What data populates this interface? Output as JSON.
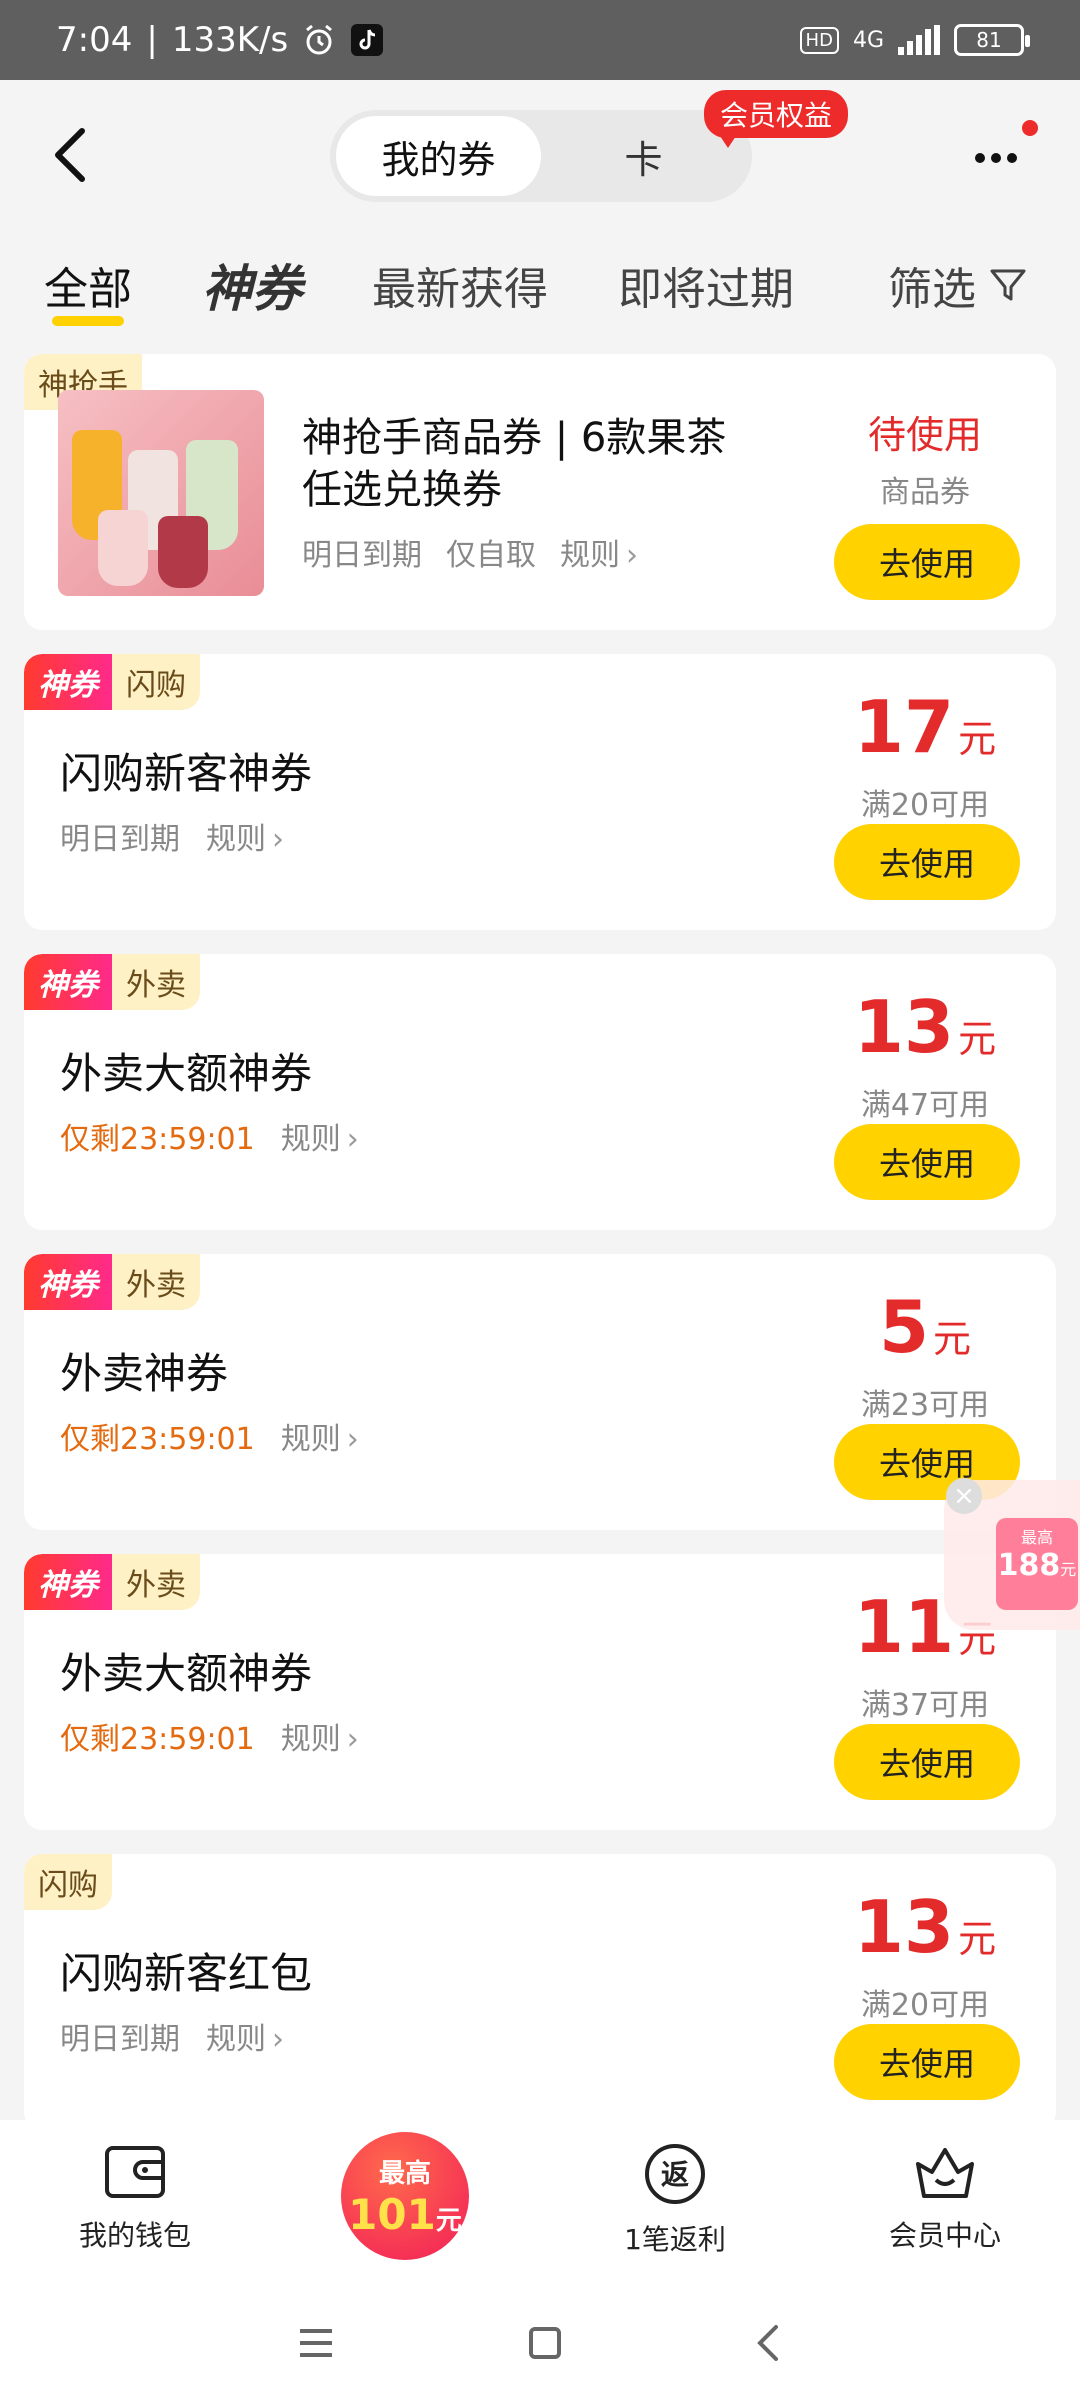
{
  "status_bar": {
    "time": "7:04",
    "speed": "133K/s",
    "network": "4G",
    "battery": "81"
  },
  "header": {
    "segment_mine": "我的券",
    "segment_card": "卡",
    "member_badge": "会员权益"
  },
  "tabs": [
    {
      "label": "全部"
    },
    {
      "label": "神券"
    },
    {
      "label": "最新获得"
    },
    {
      "label": "即将过期"
    },
    {
      "label": "筛选"
    }
  ],
  "product_coupon": {
    "corner_tag": "神抢手",
    "title_line1": "神抢手商品券 | 6款果茶",
    "title_line2": "任选兑换券",
    "meta_expire": "明日到期",
    "meta_pickup": "仅自取",
    "meta_rule": "规则",
    "status": "待使用",
    "status_sub": "商品券",
    "use_label": "去使用"
  },
  "coupons": [
    {
      "tag_shen": "神券",
      "tag_cat": "闪购",
      "title": "闪购新客神券",
      "meta": "明日到期",
      "rule": "规则",
      "amount": "17",
      "unit": "元",
      "cond": "满20可用",
      "use": "去使用"
    },
    {
      "tag_shen": "神券",
      "tag_cat": "外卖",
      "title": "外卖大额神券",
      "meta": "仅剩23:59:01",
      "rule": "规则",
      "amount": "13",
      "unit": "元",
      "cond": "满47可用",
      "use": "去使用"
    },
    {
      "tag_shen": "神券",
      "tag_cat": "外卖",
      "title": "外卖神券",
      "meta": "仅剩23:59:01",
      "rule": "规则",
      "amount": "5",
      "unit": "元",
      "cond": "满23可用",
      "use": "去使用"
    },
    {
      "tag_shen": "神券",
      "tag_cat": "外卖",
      "title": "外卖大额神券",
      "meta": "仅剩23:59:01",
      "rule": "规则",
      "amount": "11",
      "unit": "元",
      "cond": "满37可用",
      "use": "去使用"
    },
    {
      "tag_shen": "",
      "tag_cat": "闪购",
      "title": "闪购新客红包",
      "meta": "明日到期",
      "rule": "规则",
      "amount": "13",
      "unit": "元",
      "cond": "满20可用",
      "use": "去使用"
    }
  ],
  "float_widget": {
    "top": "最高",
    "amount": "188",
    "unit": "元"
  },
  "bottom_nav": {
    "wallet": "我的钱包",
    "center_top": "最高",
    "center_amount": "101",
    "center_unit": "元",
    "rebate_icon": "返",
    "rebate": "1笔返利",
    "member": "会员中心"
  },
  "colors": {
    "accent_yellow": "#ffd200",
    "price_red": "#e32b2b",
    "warn_orange": "#e46a10"
  }
}
